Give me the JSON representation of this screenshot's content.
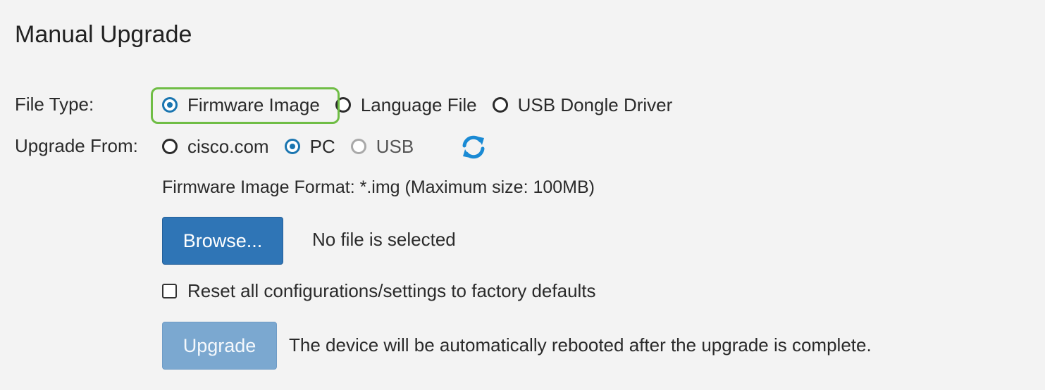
{
  "page": {
    "title": "Manual Upgrade"
  },
  "file_type": {
    "label": "File Type:",
    "options": [
      {
        "label": "Firmware Image",
        "checked": true
      },
      {
        "label": "Language File",
        "checked": false
      },
      {
        "label": "USB Dongle Driver",
        "checked": false
      }
    ]
  },
  "upgrade_from": {
    "label": "Upgrade From:",
    "options": [
      {
        "label": "cisco.com",
        "checked": false
      },
      {
        "label": "PC",
        "checked": true
      },
      {
        "label": "USB",
        "checked": false,
        "disabled": true
      }
    ],
    "refresh_icon": "refresh-icon"
  },
  "format_info": "Firmware Image Format: *.img (Maximum size: 100MB)",
  "browse": {
    "button_label": "Browse...",
    "file_status": "No file is selected"
  },
  "reset_option": {
    "label": "Reset all configurations/settings to factory defaults",
    "checked": false
  },
  "upgrade": {
    "button_label": "Upgrade",
    "note": "The device will be automatically rebooted after the upgrade is complete."
  },
  "colors": {
    "background": "#f3f3f3",
    "accent": "#1a75b0",
    "primary_button": "#2f75b6",
    "disabled_button": "#7ba8d0",
    "highlight": "#6fbd45"
  }
}
